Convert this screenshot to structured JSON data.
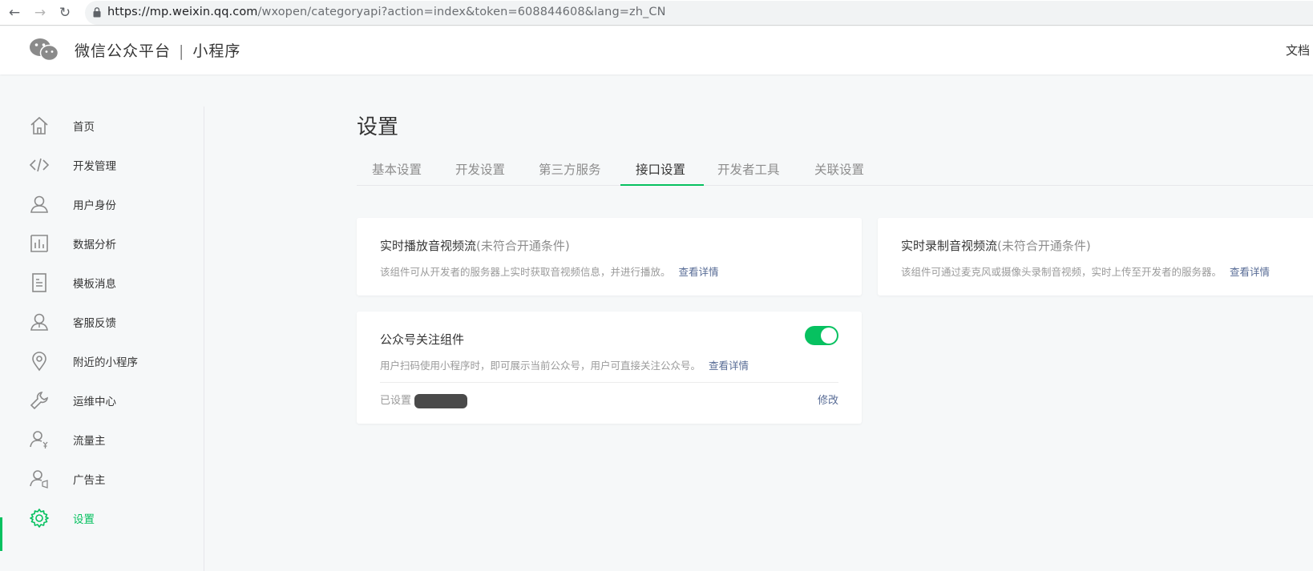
{
  "browser": {
    "url_host": "https://mp.weixin.qq.com",
    "url_path": "/wxopen/categoryapi?action=index&token=608844608&lang=zh_CN"
  },
  "header": {
    "brand_name": "微信公众平台",
    "brand_separator": "|",
    "product_name": "小程序",
    "doc_link": "文档"
  },
  "sidebar": {
    "items": [
      {
        "label": "首页",
        "icon": "home-icon"
      },
      {
        "label": "开发管理",
        "icon": "code-icon"
      },
      {
        "label": "用户身份",
        "icon": "user-icon"
      },
      {
        "label": "数据分析",
        "icon": "chart-icon"
      },
      {
        "label": "模板消息",
        "icon": "document-icon"
      },
      {
        "label": "客服反馈",
        "icon": "customer-service-icon"
      },
      {
        "label": "附近的小程序",
        "icon": "location-pin-icon"
      },
      {
        "label": "运维中心",
        "icon": "wrench-icon"
      },
      {
        "label": "流量主",
        "icon": "user-yen-icon"
      },
      {
        "label": "广告主",
        "icon": "user-ad-icon"
      },
      {
        "label": "设置",
        "icon": "gear-icon",
        "active": true
      }
    ]
  },
  "main": {
    "title": "设置",
    "tabs": [
      {
        "label": "基本设置"
      },
      {
        "label": "开发设置"
      },
      {
        "label": "第三方服务"
      },
      {
        "label": "接口设置",
        "active": true
      },
      {
        "label": "开发者工具"
      },
      {
        "label": "关联设置"
      }
    ],
    "cards": {
      "live_play": {
        "title": "实时播放音视频流",
        "condition": "(未符合开通条件)",
        "desc": "该组件可从开发者的服务器上实时获取音视频信息，并进行播放。",
        "link": "查看详情"
      },
      "live_record": {
        "title": "实时录制音视频流",
        "condition": "(未符合开通条件)",
        "desc": "该组件可通过麦克风或摄像头录制音视频，实时上传至开发者的服务器。",
        "link": "查看详情"
      },
      "follow": {
        "title": "公众号关注组件",
        "desc": "用户扫码使用小程序时，即可展示当前公众号，用户可直接关注公众号。",
        "link": "查看详情",
        "toggle_on": true,
        "set_label": "已设置",
        "edit_label": "修改"
      }
    }
  },
  "colors": {
    "accent": "#07c160",
    "link": "#576b95",
    "background": "#f6f8f9"
  }
}
